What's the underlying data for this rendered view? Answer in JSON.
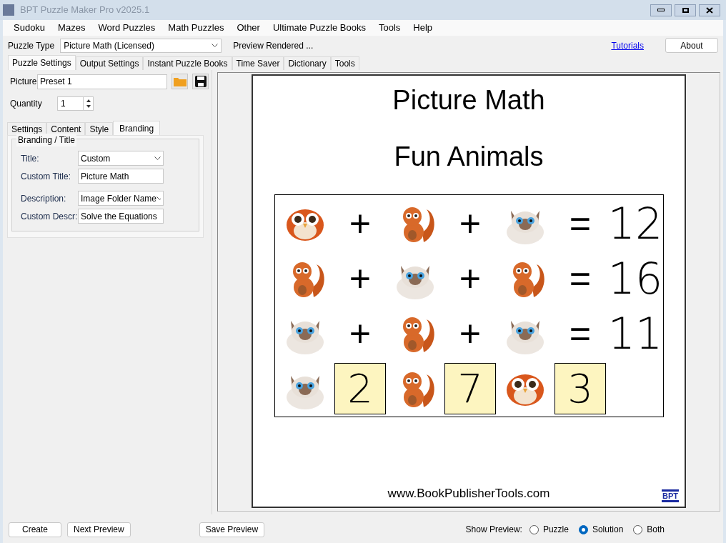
{
  "window": {
    "title": "BPT Puzzle Maker Pro v2025.1"
  },
  "menu": [
    "Sudoku",
    "Mazes",
    "Word Puzzles",
    "Math Puzzles",
    "Other",
    "Ultimate Puzzle Books",
    "Tools",
    "Help"
  ],
  "toolbar": {
    "puzzle_type_label": "Puzzle Type",
    "puzzle_type": "Picture Math (Licensed)",
    "status": "Preview Rendered ...",
    "link": "Tutorials",
    "about": "About"
  },
  "tabs": [
    {
      "label": "Puzzle Settings",
      "selected": true
    },
    {
      "label": "Output Settings",
      "selected": false
    },
    {
      "label": "Instant Puzzle Books",
      "selected": false
    },
    {
      "label": "Time Saver",
      "selected": false
    },
    {
      "label": "Dictionary",
      "selected": false
    },
    {
      "label": "Tools",
      "selected": false
    }
  ],
  "picture": {
    "label": "Picture",
    "value": "Preset 1"
  },
  "quantity": {
    "label": "Quantity",
    "value": "1"
  },
  "subtabs": [
    {
      "label": "Settings",
      "selected": false
    },
    {
      "label": "Content",
      "selected": false
    },
    {
      "label": "Style",
      "selected": false
    },
    {
      "label": "Branding",
      "selected": true
    }
  ],
  "group": {
    "title": "Branding / Title",
    "fields": [
      {
        "kind": "dropdown",
        "label": "Title:",
        "value": "Custom"
      },
      {
        "kind": "text",
        "label": "Custom Title:",
        "value": "Picture Math"
      },
      {
        "kind": "dropdown",
        "label": "Description:",
        "value": "Image Folder Name"
      },
      {
        "kind": "text",
        "label": "Custom Descr:",
        "value": "Solve the Equations"
      }
    ]
  },
  "preview": {
    "title": "Picture Math",
    "subtitle": "Fun Animals",
    "footer": "www.BookPublisherTools.com",
    "logo": "BPT",
    "rows": [
      [
        {
          "kind": "bird"
        },
        {
          "kind": "symbol",
          "text": "+"
        },
        {
          "kind": "squirrel"
        },
        {
          "kind": "symbol",
          "text": "+"
        },
        {
          "kind": "cat"
        },
        {
          "kind": "symbol",
          "text": "="
        },
        {
          "kind": "number",
          "text": "12"
        }
      ],
      [
        {
          "kind": "squirrel"
        },
        {
          "kind": "symbol",
          "text": "+"
        },
        {
          "kind": "cat"
        },
        {
          "kind": "symbol",
          "text": "+"
        },
        {
          "kind": "squirrel"
        },
        {
          "kind": "symbol",
          "text": "="
        },
        {
          "kind": "number",
          "text": "16"
        }
      ],
      [
        {
          "kind": "cat"
        },
        {
          "kind": "symbol",
          "text": "+"
        },
        {
          "kind": "squirrel"
        },
        {
          "kind": "symbol",
          "text": "+"
        },
        {
          "kind": "cat"
        },
        {
          "kind": "symbol",
          "text": "="
        },
        {
          "kind": "number",
          "text": "11"
        }
      ],
      [
        {
          "kind": "cat"
        },
        {
          "kind": "answer",
          "text": "2"
        },
        {
          "kind": "squirrel"
        },
        {
          "kind": "answer",
          "text": "7"
        },
        {
          "kind": "bird"
        },
        {
          "kind": "answer",
          "text": "3"
        }
      ]
    ]
  },
  "bottom": {
    "buttons": [
      "Create",
      "Next Preview"
    ],
    "save": "Save Preview",
    "show_label": "Show Preview:",
    "options": [
      {
        "label": "Puzzle",
        "selected": false
      },
      {
        "label": "Solution",
        "selected": true
      },
      {
        "label": "Both",
        "selected": false
      }
    ]
  }
}
